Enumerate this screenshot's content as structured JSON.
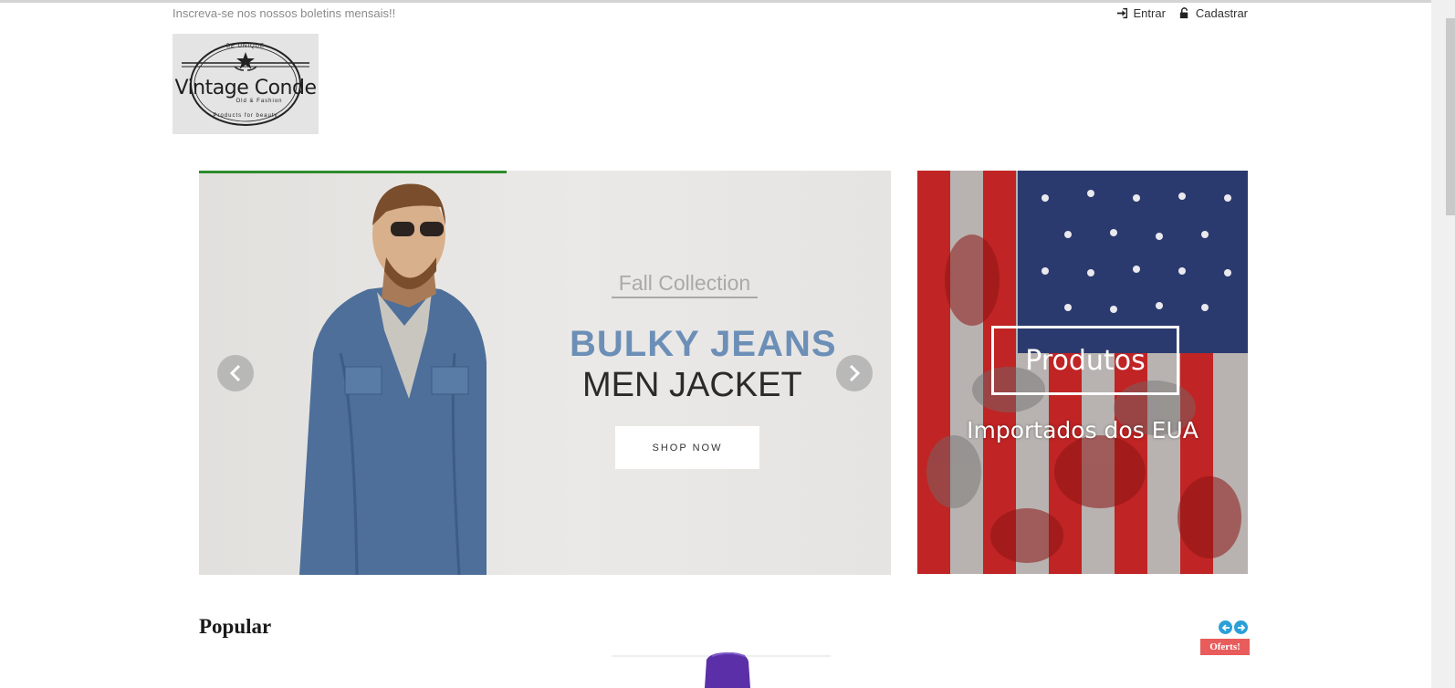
{
  "topbar": {
    "newsletter_text": "Inscreva-se nos nossos boletins mensais!!",
    "login_label": "Entrar",
    "register_label": "Cadastrar"
  },
  "logo": {
    "title": "Vintage Conde",
    "tagline_top": "BE UNIQUE",
    "tagline_sub": "Old & Fashion",
    "tagline_bottom": "Products for beauty"
  },
  "slider": {
    "kicker": "Fall Collection",
    "title": "BULKY JEANS",
    "subtitle": "MEN JACKET",
    "cta_label": "SHOP NOW",
    "progress": 0.445,
    "title_color": "#6c8fb7"
  },
  "banner": {
    "box_label": "Produtos",
    "subtitle": "Importados dos EUA"
  },
  "popular": {
    "title": "Popular",
    "offer_badge": "Oferts!",
    "badge_color": "#e85c5c",
    "nav_color": "#2a9fd8"
  },
  "icons": {
    "login": "sign-in-icon",
    "register": "lock-icon",
    "prev": "chevron-left-icon",
    "next": "chevron-right-icon"
  }
}
